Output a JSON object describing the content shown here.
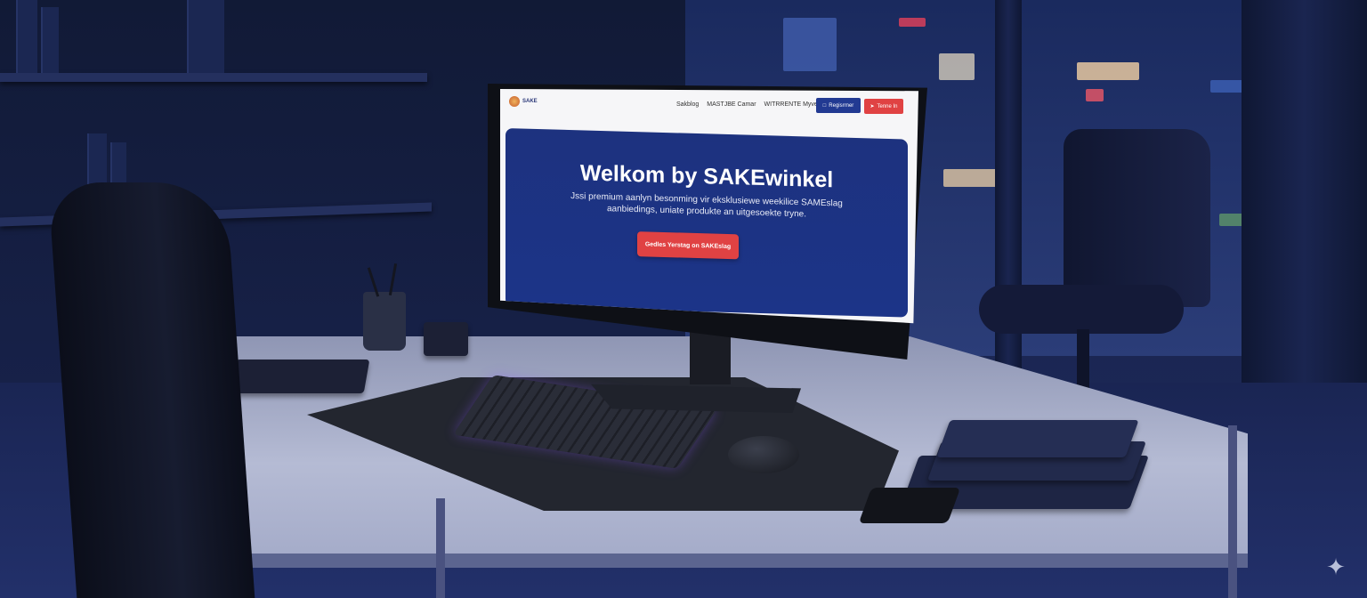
{
  "site": {
    "logo_text": "SAKE",
    "nav": [
      {
        "label": "Sakblog"
      },
      {
        "label": "MASTJBE Camar"
      },
      {
        "label": "WITRRENTE Myve"
      }
    ],
    "register_label": "Regisrrner",
    "login_label": "Tenne In",
    "hero": {
      "title": "Welkom by SAKEwinkel",
      "subtitle": "Jssi premium aanlyn besonming vir eksklusiewe weekilice SAMEslag aanbiedings, uniate produkte an uitgesoekte tryne.",
      "cta_label": "Gedles Yerstag on SAKEslag"
    }
  },
  "colors": {
    "primary": "#1d327f",
    "accent": "#e04243",
    "register_bg": "#223a92"
  },
  "icons": {
    "register": "user-icon",
    "login": "login-arrow-icon",
    "corner": "sparkle-icon"
  }
}
